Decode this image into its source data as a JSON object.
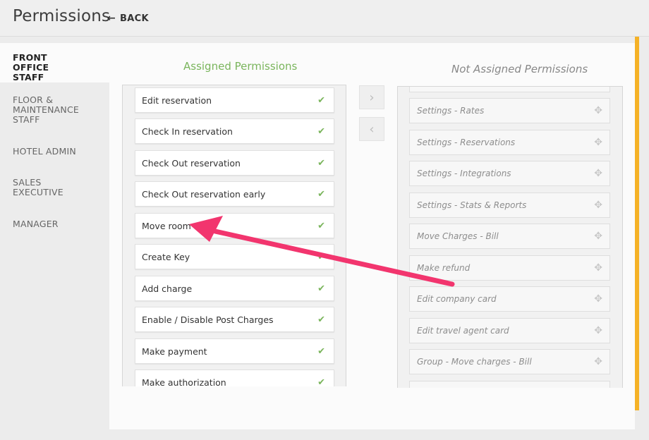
{
  "header": {
    "title": "Permissions",
    "back_label": "BACK"
  },
  "sidebar": {
    "items": [
      {
        "label": "FRONT OFFICE STAFF",
        "active": true
      },
      {
        "label": "FLOOR & MAINTENANCE STAFF",
        "active": false
      },
      {
        "label": "HOTEL ADMIN",
        "active": false
      },
      {
        "label": "SALES EXECUTIVE",
        "active": false
      },
      {
        "label": "MANAGER",
        "active": false
      }
    ]
  },
  "assigned": {
    "title": "Assigned Permissions",
    "items": [
      "Edit reservation",
      "Check In reservation",
      "Check Out reservation",
      "Check Out reservation early",
      "Move room",
      "Create Key",
      "Add charge",
      "Enable / Disable Post Charges",
      "Make payment",
      "Make authorization"
    ]
  },
  "not_assigned": {
    "title": "Not Assigned Permissions",
    "items": [
      "Settings - Rates",
      "Settings - Reservations",
      "Settings - Integrations",
      "Settings - Stats & Reports",
      "Move Charges - Bill",
      "Make refund",
      "Edit company card",
      "Edit travel agent card",
      "Group - Move charges - Bill"
    ]
  },
  "colors": {
    "accent_green": "#7ab55c",
    "accent_yellow": "#f5b227",
    "annotation_pink": "#f2356e"
  },
  "icons": {
    "check": "check-icon",
    "move": "move-icon",
    "back": "left-arrow-icon"
  }
}
